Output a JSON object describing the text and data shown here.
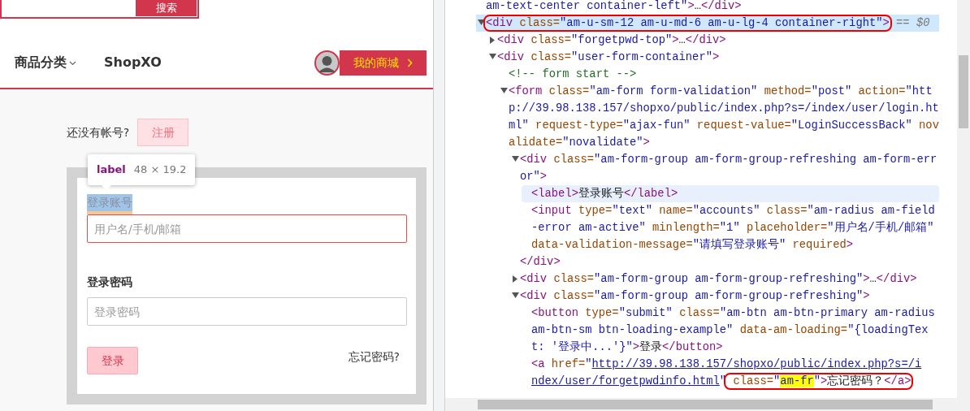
{
  "store": {
    "search_button": "搜索",
    "nav": [
      {
        "label": "商品分类",
        "dropdown": true
      },
      {
        "label": "ShopXO",
        "dropdown": false
      }
    ],
    "my_store_button": "我的商城"
  },
  "login": {
    "register_prompt": "还没有帐号?",
    "register_button": "注册",
    "fields": [
      {
        "label": "登录账号",
        "placeholder": "用户名/手机/邮箱",
        "error": true,
        "inspected": true
      },
      {
        "label": "登录密码",
        "placeholder": "登录密码",
        "error": false,
        "inspected": false
      }
    ],
    "submit_button": "登录",
    "forgot_link": "忘记密码?"
  },
  "inspector_tooltip": {
    "tag": "label",
    "size": "48 × 19.2"
  },
  "dom_tree": [
    {
      "selected": false,
      "hovered": false,
      "segments": [
        {
          "kind": "value",
          "text": "am-text-center container-left\""
        },
        {
          "kind": "tag",
          "text": ">"
        },
        {
          "kind": "text",
          "text": "…"
        },
        {
          "kind": "tag",
          "text": "</div>"
        }
      ]
    },
    {
      "expanded": true,
      "selected": true,
      "hovered": false,
      "boxed": true,
      "console_ref": "== $0",
      "segments": [
        {
          "kind": "tag",
          "text": "<div "
        },
        {
          "kind": "attr",
          "text": "class="
        },
        {
          "kind": "value",
          "text": "\"am-u-sm-12 am-u-md-6 am-u-lg-4 container-right\""
        },
        {
          "kind": "tag",
          "text": ">"
        }
      ],
      "children": [
        {
          "expanded": false,
          "selected": false,
          "hovered": false,
          "segments": [
            {
              "kind": "tag",
              "text": "<div "
            },
            {
              "kind": "attr",
              "text": "class="
            },
            {
              "kind": "value",
              "text": "\"forgetpwd-top\""
            },
            {
              "kind": "tag",
              "text": ">"
            },
            {
              "kind": "text",
              "text": "…"
            },
            {
              "kind": "tag",
              "text": "</div>"
            }
          ]
        },
        {
          "expanded": true,
          "selected": false,
          "hovered": false,
          "segments": [
            {
              "kind": "tag",
              "text": "<div "
            },
            {
              "kind": "attr",
              "text": "class="
            },
            {
              "kind": "value",
              "text": "\"user-form-container\""
            },
            {
              "kind": "tag",
              "text": ">"
            }
          ],
          "children": [
            {
              "selected": false,
              "hovered": false,
              "segments": [
                {
                  "kind": "comment",
                  "text": "<!-- form start -->"
                }
              ]
            },
            {
              "expanded": true,
              "selected": false,
              "hovered": false,
              "segments": [
                {
                  "kind": "tag",
                  "text": "<form "
                },
                {
                  "kind": "attr",
                  "text": "class="
                },
                {
                  "kind": "value",
                  "text": "\"am-form form-validation\""
                },
                {
                  "kind": "attr",
                  "text": " method="
                },
                {
                  "kind": "value",
                  "text": "\"post\""
                },
                {
                  "kind": "attr",
                  "text": " action="
                },
                {
                  "kind": "value",
                  "text": "\"http://39.98.138.157/shopxo/public/index.php?s=/index/user/login.html\""
                },
                {
                  "kind": "attr",
                  "text": " request-type="
                },
                {
                  "kind": "value",
                  "text": "\"ajax-fun\""
                },
                {
                  "kind": "attr",
                  "text": " request-value="
                },
                {
                  "kind": "value",
                  "text": "\"LoginSuccessBack\""
                },
                {
                  "kind": "attr",
                  "text": " novalidate="
                },
                {
                  "kind": "value",
                  "text": "\"novalidate\""
                },
                {
                  "kind": "tag",
                  "text": ">"
                }
              ],
              "children": [
                {
                  "expanded": true,
                  "selected": false,
                  "hovered": false,
                  "closing": "</div>",
                  "segments": [
                    {
                      "kind": "tag",
                      "text": "<div "
                    },
                    {
                      "kind": "attr",
                      "text": "class="
                    },
                    {
                      "kind": "value",
                      "text": "\"am-form-group am-form-group-refreshing am-form-error\""
                    },
                    {
                      "kind": "tag",
                      "text": ">"
                    }
                  ],
                  "children": [
                    {
                      "selected": false,
                      "hovered": true,
                      "segments": [
                        {
                          "kind": "tag",
                          "text": "<label>"
                        },
                        {
                          "kind": "text",
                          "text": "登录账号"
                        },
                        {
                          "kind": "tag",
                          "text": "</label>"
                        }
                      ]
                    },
                    {
                      "selected": false,
                      "hovered": false,
                      "segments": [
                        {
                          "kind": "tag",
                          "text": "<input "
                        },
                        {
                          "kind": "attr",
                          "text": "type="
                        },
                        {
                          "kind": "value",
                          "text": "\"text\""
                        },
                        {
                          "kind": "attr",
                          "text": " name="
                        },
                        {
                          "kind": "value",
                          "text": "\"accounts\""
                        },
                        {
                          "kind": "attr",
                          "text": " class="
                        },
                        {
                          "kind": "value",
                          "text": "\"am-radius am-field-error am-active\""
                        },
                        {
                          "kind": "attr",
                          "text": " minlength="
                        },
                        {
                          "kind": "value",
                          "text": "\"1\""
                        },
                        {
                          "kind": "attr",
                          "text": " placeholder="
                        },
                        {
                          "kind": "value",
                          "text": "\"用户名/手机/邮箱\""
                        },
                        {
                          "kind": "attr",
                          "text": " data-validation-message="
                        },
                        {
                          "kind": "value",
                          "text": "\"请填写登录账号\""
                        },
                        {
                          "kind": "attr",
                          "text": " required"
                        },
                        {
                          "kind": "tag",
                          "text": ">"
                        }
                      ]
                    }
                  ]
                },
                {
                  "expanded": false,
                  "selected": false,
                  "hovered": false,
                  "segments": [
                    {
                      "kind": "tag",
                      "text": "<div "
                    },
                    {
                      "kind": "attr",
                      "text": "class="
                    },
                    {
                      "kind": "value",
                      "text": "\"am-form-group am-form-group-refreshing\""
                    },
                    {
                      "kind": "tag",
                      "text": ">"
                    },
                    {
                      "kind": "text",
                      "text": "…"
                    },
                    {
                      "kind": "tag",
                      "text": "</div>"
                    }
                  ]
                },
                {
                  "expanded": true,
                  "selected": false,
                  "hovered": false,
                  "segments": [
                    {
                      "kind": "tag",
                      "text": "<div "
                    },
                    {
                      "kind": "attr",
                      "text": "class="
                    },
                    {
                      "kind": "value",
                      "text": "\"am-form-group am-form-group-refreshing\""
                    },
                    {
                      "kind": "tag",
                      "text": ">"
                    }
                  ],
                  "children": [
                    {
                      "selected": false,
                      "hovered": false,
                      "segments": [
                        {
                          "kind": "tag",
                          "text": "<button "
                        },
                        {
                          "kind": "attr",
                          "text": "type="
                        },
                        {
                          "kind": "value",
                          "text": "\"submit\""
                        },
                        {
                          "kind": "attr",
                          "text": " class="
                        },
                        {
                          "kind": "value",
                          "text": "\"am-btn am-btn-primary am-radius am-btn-sm btn-loading-example\""
                        },
                        {
                          "kind": "attr",
                          "text": " data-am-loading="
                        },
                        {
                          "kind": "value",
                          "text": "\"{loadingText: '登录中...'}\""
                        },
                        {
                          "kind": "tag",
                          "text": ">"
                        },
                        {
                          "kind": "text",
                          "text": "登录"
                        },
                        {
                          "kind": "tag",
                          "text": "</button>"
                        }
                      ]
                    },
                    {
                      "selected": false,
                      "hovered": false,
                      "segments": [
                        {
                          "kind": "tag",
                          "text": "<a "
                        },
                        {
                          "kind": "attr",
                          "text": "href="
                        },
                        {
                          "kind": "value",
                          "text": "\""
                        },
                        {
                          "kind": "link",
                          "text": "http://39.98.138.157/shopxo/public/index.php?s=/i"
                        },
                        {
                          "kind": "link",
                          "text": "ndex/user/forgetpwdinfo.html"
                        },
                        {
                          "kind": "value",
                          "text": "\""
                        }
                      ],
                      "boxed_tail": [
                        {
                          "kind": "attr",
                          "text": " class="
                        },
                        {
                          "kind": "value",
                          "text": "\""
                        },
                        {
                          "kind": "match",
                          "text": "am-fr"
                        },
                        {
                          "kind": "value",
                          "text": "\""
                        },
                        {
                          "kind": "tag",
                          "text": ">"
                        },
                        {
                          "kind": "text",
                          "text": "忘记密码？"
                        },
                        {
                          "kind": "tag",
                          "text": "</a>"
                        }
                      ]
                    }
                  ]
                }
              ]
            }
          ]
        }
      ]
    }
  ]
}
